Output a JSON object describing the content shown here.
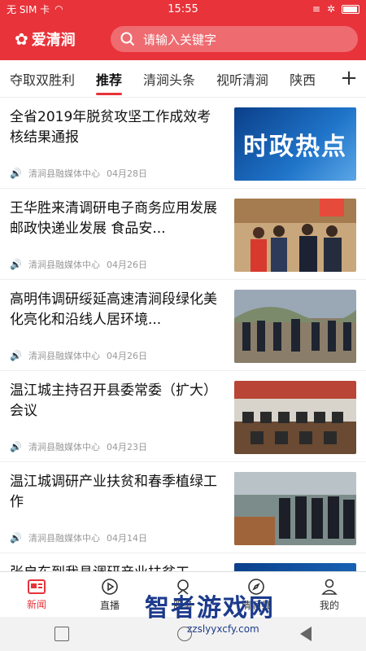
{
  "status": {
    "carrier": "无 SIM 卡",
    "time": "15:55"
  },
  "header": {
    "logo": "爱清涧",
    "search_placeholder": "请输入关键字"
  },
  "tabs": [
    "夺取双胜利",
    "推荐",
    "清涧头条",
    "视听清涧",
    "陕西"
  ],
  "active_tab": 1,
  "articles": [
    {
      "title": "全省2019年脱贫攻坚工作成效考核结果通报",
      "source": "清涧县融媒体中心",
      "date": "04月28日",
      "thumb_text": "时政热点"
    },
    {
      "title": "王华胜来清调研电子商务应用发展 邮政快递业发展 食品安...",
      "source": "清涧县融媒体中心",
      "date": "04月26日",
      "thumb_text": ""
    },
    {
      "title": "高明伟调研绥延高速清涧段绿化美化亮化和沿线人居环境...",
      "source": "清涧县融媒体中心",
      "date": "04月26日",
      "thumb_text": ""
    },
    {
      "title": "温江城主持召开县委常委（扩大）会议",
      "source": "清涧县融媒体中心",
      "date": "04月23日",
      "thumb_text": ""
    },
    {
      "title": "温江城调研产业扶贫和春季植绿工作",
      "source": "清涧县融媒体中心",
      "date": "04月14日",
      "thumb_text": ""
    },
    {
      "title": "张启东到我县调研产业扶贫工",
      "source": "",
      "date": "",
      "thumb_text": ""
    }
  ],
  "tabbar": [
    {
      "label": "新闻",
      "icon": "news-icon"
    },
    {
      "label": "直播",
      "icon": "play-icon"
    },
    {
      "label": "服务",
      "icon": "service-icon"
    },
    {
      "label": "清涧县",
      "icon": "compass-icon"
    },
    {
      "label": "我的",
      "icon": "user-icon"
    }
  ],
  "watermark": {
    "title": "智者游戏网",
    "url": "zzslyyxcfy.com"
  },
  "colors": {
    "brand_red": "#e8333a"
  }
}
